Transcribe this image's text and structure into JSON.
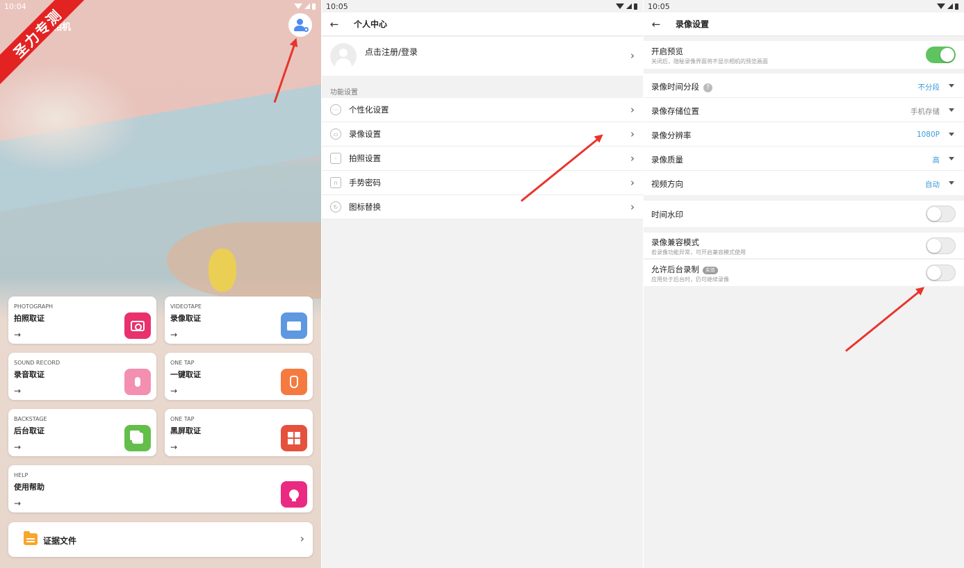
{
  "colors": {
    "accent_blue": "#3a9ad9",
    "toggle_on": "#5fc45f",
    "watermark_red": "#e32222",
    "arrow_red": "#e8352c"
  },
  "left": {
    "time": "10:04",
    "watermark": "圣力专测",
    "app_title": "相机",
    "user_icon": "user-settings-icon",
    "cards": [
      {
        "en": "PHOTOGRAPH",
        "cn": "拍照取证",
        "arrow": "→",
        "icon": "camera-icon",
        "color": "#e8316d"
      },
      {
        "en": "VIDEOTAPE",
        "cn": "录像取证",
        "arrow": "→",
        "icon": "video-icon",
        "color": "#5e98e0"
      },
      {
        "en": "SOUND RECORD",
        "cn": "录音取证",
        "arrow": "→",
        "icon": "microphone-icon",
        "color": "#f38fb1"
      },
      {
        "en": "ONE TAP",
        "cn": "一键取证",
        "arrow": "→",
        "icon": "hand-tap-icon",
        "color": "#f57a3f"
      },
      {
        "en": "BACKSTAGE",
        "cn": "后台取证",
        "arrow": "→",
        "icon": "layers-icon",
        "color": "#63be4a"
      },
      {
        "en": "ONE TAP",
        "cn": "黑屏取证",
        "arrow": "→",
        "icon": "grid-icon",
        "color": "#e5513d"
      },
      {
        "en": "HELP",
        "cn": "使用帮助",
        "arrow": "→",
        "icon": "lightbulb-icon",
        "color": "#ea2a82"
      }
    ],
    "files": {
      "label": "证据文件",
      "icon": "folder-icon",
      "chevron": "›"
    }
  },
  "middle": {
    "time": "10:05",
    "back": "←",
    "title": "个人中心",
    "profile_text": "点击注册/登录",
    "chevron": "›",
    "section_title": "功能设置",
    "menu": [
      {
        "label": "个性化设置",
        "icon": "more-circle-icon"
      },
      {
        "label": "录像设置",
        "icon": "video-settings-icon"
      },
      {
        "label": "拍照设置",
        "icon": "camera-icon"
      },
      {
        "label": "手势密码",
        "icon": "lock-icon"
      },
      {
        "label": "图标替换",
        "icon": "refresh-icon"
      }
    ]
  },
  "right": {
    "time": "10:05",
    "back": "←",
    "title": "录像设置",
    "preview": {
      "label": "开启预览",
      "sub": "关闭后，隐秘录像界面将不显示相机的预览画面",
      "on": true
    },
    "segment": {
      "label": "录像时间分段",
      "help": "?",
      "value": "不分段"
    },
    "storage": {
      "label": "录像存储位置",
      "value": "手机存储"
    },
    "resolution": {
      "label": "录像分辨率",
      "value": "1080P"
    },
    "quality": {
      "label": "录像质量",
      "value": "高"
    },
    "orientation": {
      "label": "视频方向",
      "value": "自动"
    },
    "watermark": {
      "label": "时间水印",
      "on": false
    },
    "compat": {
      "label": "录像兼容模式",
      "sub": "若录像功能异常，可开启兼容模式使用",
      "on": false
    },
    "background": {
      "label": "允许后台录制",
      "tag": "实验",
      "sub": "应用处于后台时，仍可继续录像",
      "on": false
    }
  }
}
